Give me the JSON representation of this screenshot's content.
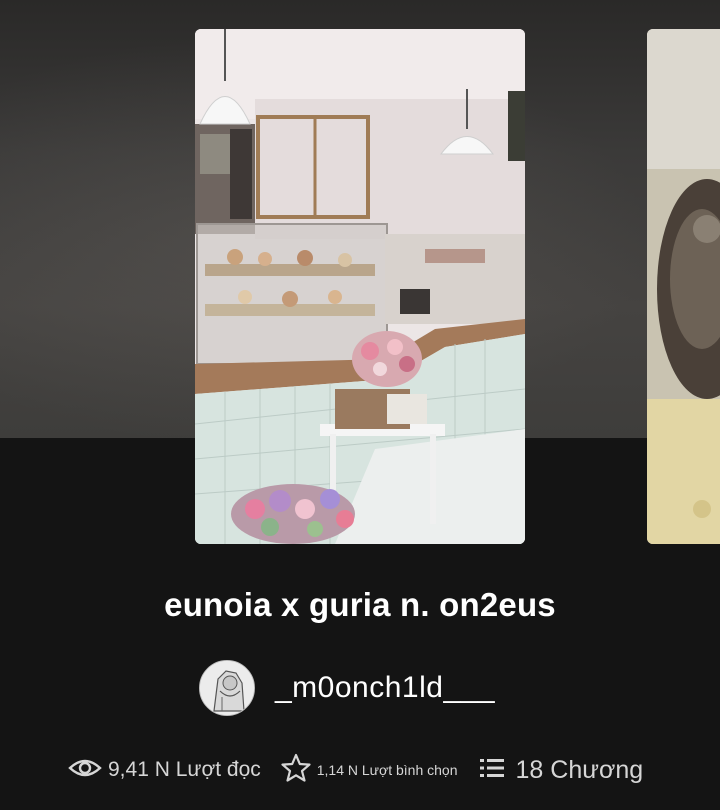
{
  "story": {
    "title": "eunoia x guria n. on2eus",
    "author": "_m0onch1ld___"
  },
  "stats": {
    "reads": "9,41 N Lượt đọc",
    "votes": "1,14 N Lượt bình chọn",
    "parts": "18 Chương"
  },
  "icons": {
    "reads": "eye-icon",
    "votes": "star-icon",
    "parts": "list-icon"
  },
  "colors": {
    "background": "#141414",
    "text": "#ffffff",
    "stat_text": "#d6d6d6"
  }
}
